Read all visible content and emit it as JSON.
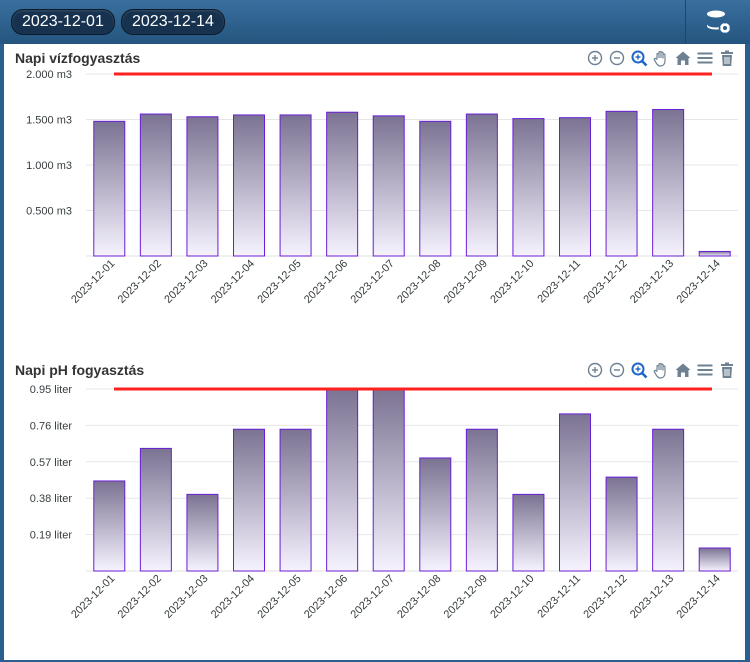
{
  "header": {
    "date_from": "2023-12-01",
    "date_to": "2023-12-14",
    "db_icon": "database-settings-icon"
  },
  "colors": {
    "bar_top": "#7b7392",
    "bar_bottom": "#f6f3ff",
    "bar_stroke": "#6a1ed6",
    "limit_line": "#ff2020",
    "toolbar_icon": "#6e8192"
  },
  "toolbar_icons": [
    "zoom-in-icon",
    "zoom-out-icon",
    "zoom-selection-icon",
    "pan-hand-icon",
    "home-reset-icon",
    "menu-icon",
    "trash-icon"
  ],
  "chart_data": [
    {
      "type": "bar",
      "title": "Napi vízfogyasztás",
      "categories": [
        "2023-12-01",
        "2023-12-02",
        "2023-12-03",
        "2023-12-04",
        "2023-12-05",
        "2023-12-06",
        "2023-12-07",
        "2023-12-08",
        "2023-12-09",
        "2023-12-10",
        "2023-12-11",
        "2023-12-12",
        "2023-12-13",
        "2023-12-14"
      ],
      "values": [
        1.48,
        1.56,
        1.53,
        1.55,
        1.55,
        1.58,
        1.54,
        1.48,
        1.56,
        1.51,
        1.52,
        1.59,
        1.61,
        0.05
      ],
      "yticks": [
        "2.000 m3",
        "1.500 m3",
        "1.000 m3",
        "0.500 m3"
      ],
      "ytick_values": [
        2.0,
        1.5,
        1.0,
        0.5
      ],
      "ylim": [
        0,
        2.0
      ],
      "limit": 2.0,
      "grid": true
    },
    {
      "type": "bar",
      "title": "Napi pH fogyasztás",
      "categories": [
        "2023-12-01",
        "2023-12-02",
        "2023-12-03",
        "2023-12-04",
        "2023-12-05",
        "2023-12-06",
        "2023-12-07",
        "2023-12-08",
        "2023-12-09",
        "2023-12-10",
        "2023-12-11",
        "2023-12-12",
        "2023-12-13",
        "2023-12-14"
      ],
      "values": [
        0.47,
        0.64,
        0.4,
        0.74,
        0.74,
        0.95,
        0.95,
        0.59,
        0.74,
        0.4,
        0.82,
        0.49,
        0.74,
        0.12
      ],
      "yticks": [
        "0.95 liter",
        "0.76 liter",
        "0.57 liter",
        "0.38 liter",
        "0.19 liter"
      ],
      "ytick_values": [
        0.95,
        0.76,
        0.57,
        0.38,
        0.19
      ],
      "ylim": [
        0,
        0.95
      ],
      "limit": 0.95,
      "grid": true
    }
  ]
}
